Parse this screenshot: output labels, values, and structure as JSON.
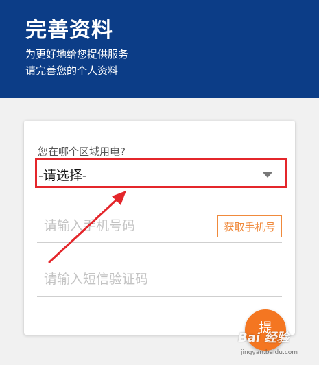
{
  "header": {
    "title": "完善资料",
    "subtitle_line1": "为更好地给您提供服务",
    "subtitle_line2": "请完善您的个人资料",
    "background_color": "#0c3d87"
  },
  "form": {
    "region_label": "您在哪个区域用电?",
    "region_select_value": "-请选择-",
    "phone_placeholder": "请输入手机号码",
    "get_code_button": "获取手机号",
    "code_placeholder": "请输入短信验证码",
    "submit_label": "提",
    "highlight_color": "#e4262b",
    "accent_color": "#f47621"
  },
  "watermark": {
    "text": "Bai 经验",
    "url": "jingyan.baidu.com"
  }
}
